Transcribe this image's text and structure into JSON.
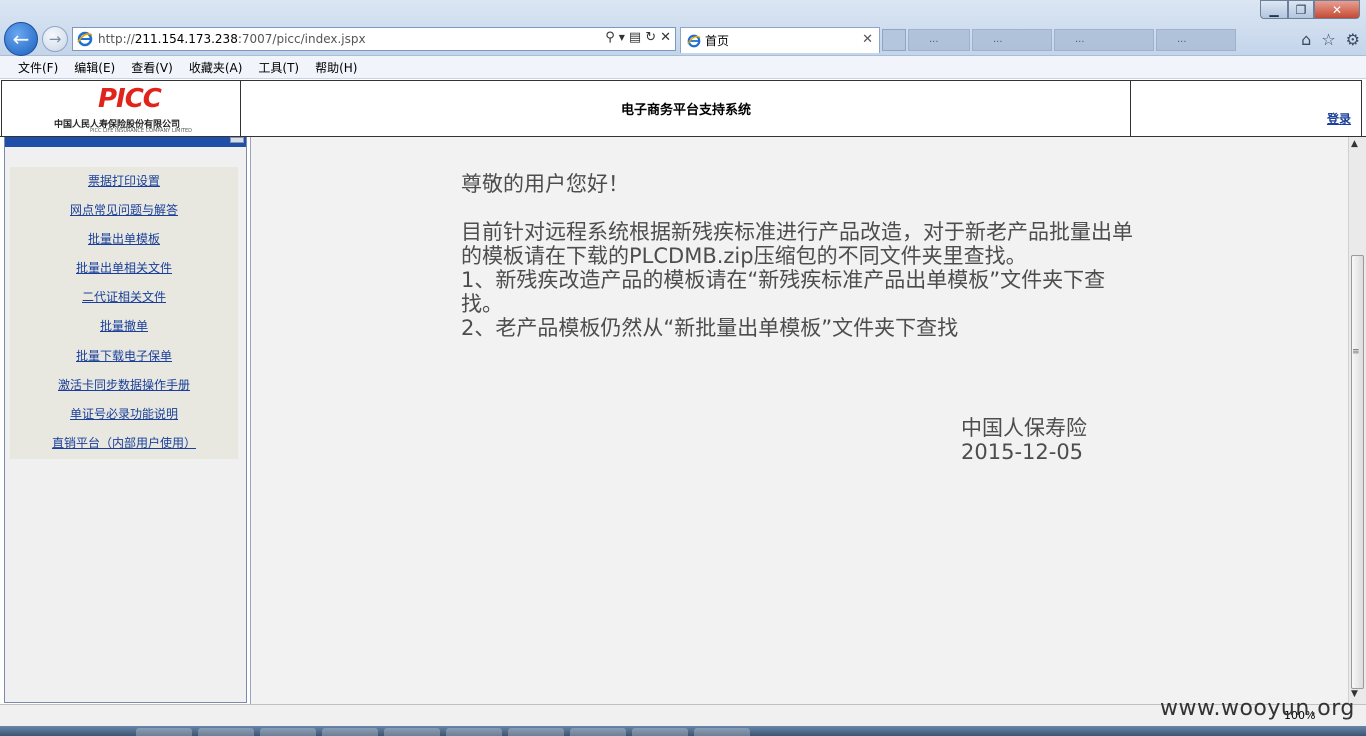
{
  "browser": {
    "url_prefix": "http://",
    "url_host": "211.154.173.238",
    "url_rest": ":7007/picc/index.jspx",
    "tab_title": "首页",
    "ghost_tabs": [
      "...",
      "...",
      "...",
      "..."
    ]
  },
  "menubar": {
    "items": [
      "文件(F)",
      "编辑(E)",
      "查看(V)",
      "收藏夹(A)",
      "工具(T)",
      "帮助(H)"
    ]
  },
  "header": {
    "logo_text": "PICC",
    "logo_cn": "中国人民人寿保险股份有限公司",
    "logo_en": "PICC LIFE INSURANCE COMPANY LIMITED",
    "system_title": "电子商务平台支持系统",
    "login_label": "登录"
  },
  "sidebar": {
    "items": [
      "票据打印设置",
      "网点常见问题与解答",
      "批量出单模板",
      "批量出单相关文件",
      "二代证相关文件",
      "批量撤单",
      "批量下载电子保单",
      "激活卡同步数据操作手册",
      "单证号必录功能说明",
      "直销平台（内部用户使用）"
    ]
  },
  "notice": {
    "greeting": "尊敬的用户您好！",
    "paragraph": "目前针对远程系统根据新残疾标准进行产品改造，对于新老产品批量出单的模板请在下载的PLCDMB.zip压缩包的不同文件夹里查找。",
    "item1": "1、新残疾改造产品的模板请在“新残疾标准产品出单模板”文件夹下查找。",
    "item2": "2、老产品模板仍然从“新批量出单模板”文件夹下查找",
    "sign_company": "中国人保寿险",
    "sign_date": "2015-12-05"
  },
  "statusbar": {
    "zoom": "100%",
    "watermark": "www.wooyun.org"
  }
}
